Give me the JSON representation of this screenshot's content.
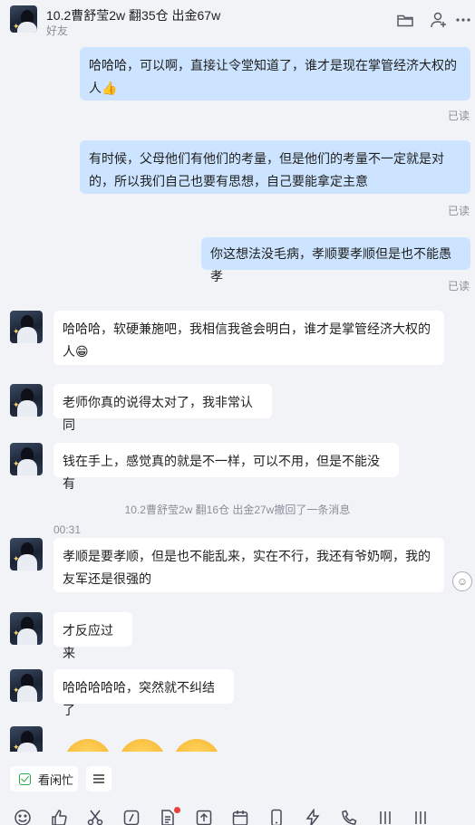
{
  "header": {
    "title": "10.2曹舒莹2w 翻35仓 出金67w",
    "subtitle": "好友",
    "icons": [
      "folder-icon",
      "add-user-icon",
      "more-icon"
    ]
  },
  "messages": {
    "m1": {
      "sender": "me",
      "text": "哈哈哈，可以啊，直接让令堂知道了，谁才是现在掌管经济大权的人👍",
      "status": "已读"
    },
    "m2": {
      "sender": "me",
      "text": "有时候，父母他们有他们的考量，但是他们的考量不一定就是对的，所以我们自己也要有思想，自己要能拿定主意",
      "status": "已读"
    },
    "m3": {
      "sender": "me",
      "text": "你这想法没毛病，孝顺要孝顺但是也不能愚孝",
      "status": "已读"
    },
    "m4": {
      "sender": "contact",
      "text": "哈哈哈，软硬兼施吧，我相信我爸会明白，谁才是掌管经济大权的人😁"
    },
    "m5": {
      "sender": "contact",
      "text": "老师你真的说得太对了，我非常认同"
    },
    "m6": {
      "sender": "contact",
      "text": "钱在手上，感觉真的就是不一样，可以不用，但是不能没有"
    },
    "system": "10.2曹舒莹2w 翻16仓 出金27w撤回了一条消息",
    "time": "00:31",
    "m7": {
      "sender": "contact",
      "text": "孝顺是要孝顺，但是也不能乱来，实在不行，我还有爷奶啊，我的友军还是很强的"
    },
    "m8": {
      "sender": "contact",
      "text": "才反应过来"
    },
    "m9": {
      "sender": "contact",
      "text": "哈哈哈哈哈，突然就不纠结了"
    },
    "m10": {
      "sender": "contact",
      "content": "three grinning emoji (partially visible)"
    }
  },
  "bottom_bar": {
    "chip_label": "看闲忙",
    "menu_icon": "menu-icon",
    "toolbar_icons": [
      "emoji-icon",
      "like-icon",
      "scissors-icon",
      "slash-command-icon",
      "document-icon",
      "upload-icon",
      "calendar-icon",
      "phone-icon",
      "lightning-icon",
      "call-icon",
      "shortcut-icon"
    ]
  },
  "colors": {
    "my_bubble": "#cce4ff",
    "their_bubble": "#ffffff",
    "background": "#f1f3f7",
    "read_text": "#8b8f99",
    "accent_green": "#27a84a",
    "badge_red": "#e8413c"
  }
}
